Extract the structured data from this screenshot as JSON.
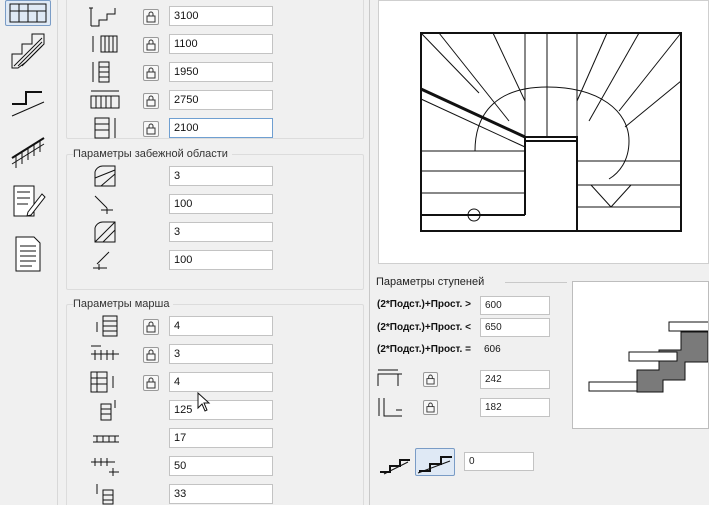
{
  "top_group": {
    "rows": [
      {
        "icon": "stair-total-height-icon",
        "value": "3100"
      },
      {
        "icon": "stair-width-icon",
        "value": "1100"
      },
      {
        "icon": "stair-depth-icon",
        "value": "1950"
      },
      {
        "icon": "stair-length-icon",
        "value": "2750"
      },
      {
        "icon": "headroom-height-icon",
        "value": "2100"
      }
    ]
  },
  "winder": {
    "title": "Параметры забежной области",
    "rows": [
      {
        "icon": "winder-steps-icon",
        "value": "3"
      },
      {
        "icon": "winder-offset-icon",
        "value": "100"
      },
      {
        "icon": "winder-steps-second-icon",
        "value": "3"
      },
      {
        "icon": "winder-offset-second-icon",
        "value": "100"
      }
    ]
  },
  "flight": {
    "title": "Параметры марша",
    "rows": [
      {
        "icon": "flight-steps-icon",
        "value": "4"
      },
      {
        "icon": "flight-treads-icon",
        "value": "3"
      },
      {
        "icon": "flight-risers-icon",
        "value": "4"
      },
      {
        "icon": "flight-riser-height-icon",
        "value": "125"
      },
      {
        "icon": "flight-nosing-icon",
        "value": "17"
      },
      {
        "icon": "flight-overhang-icon",
        "value": "50"
      },
      {
        "icon": "flight-thickness-icon",
        "value": "33"
      }
    ]
  },
  "steps": {
    "title": "Параметры ступеней",
    "rule_gt_label": "(2*Подст.)+Прост. >",
    "rule_gt_value": "600",
    "rule_lt_label": "(2*Подст.)+Прост. <",
    "rule_lt_value": "650",
    "rule_eq_label": "(2*Подст.)+Прост. =",
    "rule_eq_value": "606",
    "tread_value": "242",
    "riser_value": "182",
    "nosing_value": "0"
  },
  "colors": {
    "profile_fill": "#7a7a7a",
    "selection": "#dfe9f5"
  }
}
